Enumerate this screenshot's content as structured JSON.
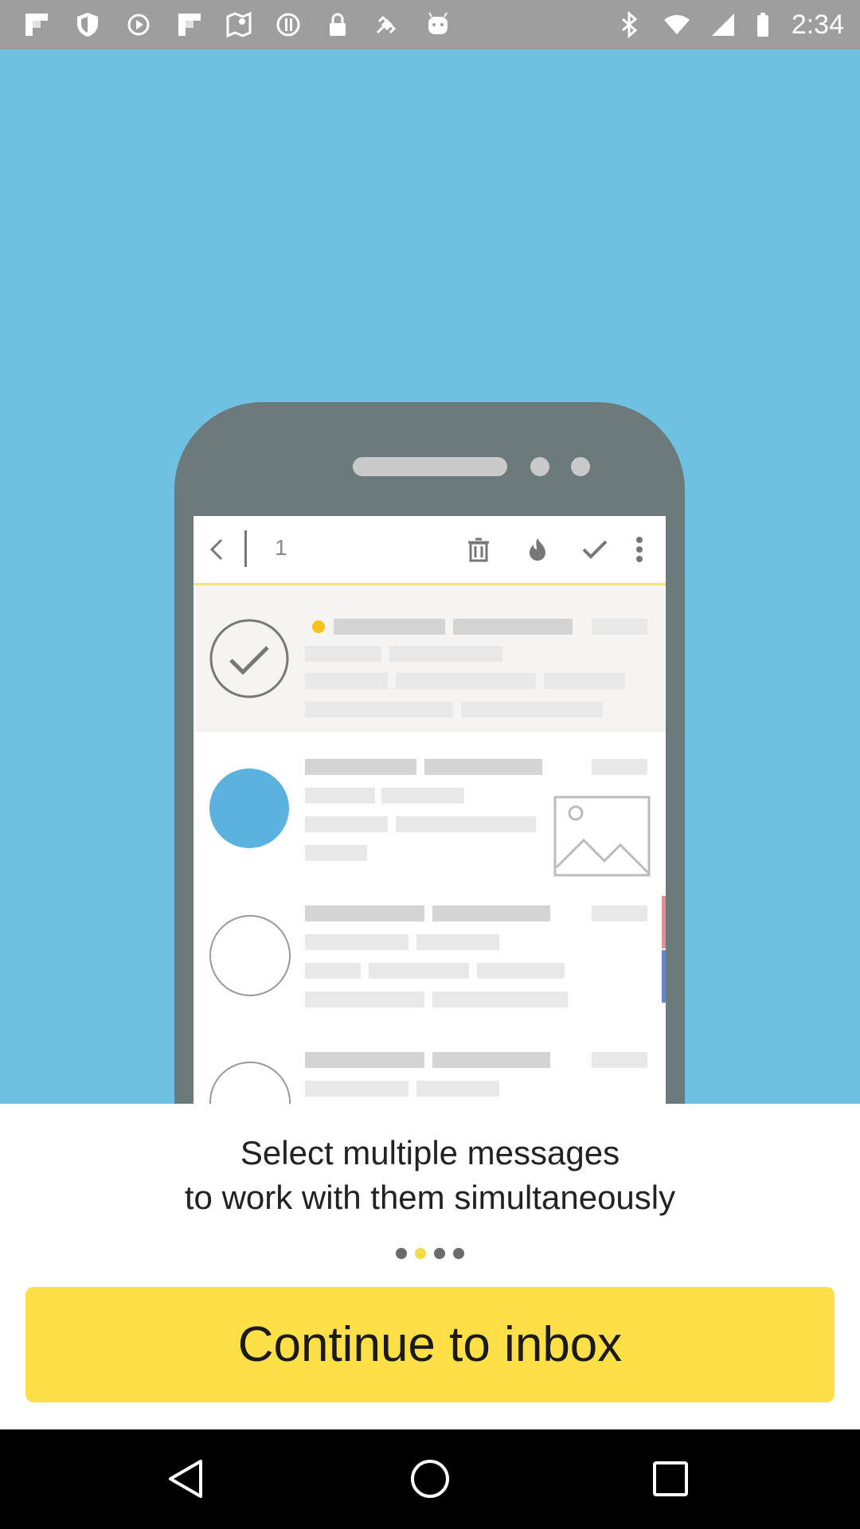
{
  "status_bar": {
    "time": "2:34",
    "left_icons": [
      "flipboard-icon",
      "shield-icon",
      "play-icon",
      "flipboard-icon-2",
      "maps-icon",
      "sync-icon",
      "lock-icon",
      "satellite-icon",
      "android-icon"
    ],
    "right_icons": [
      "bluetooth-icon",
      "wifi-icon",
      "signal-icon",
      "battery-icon"
    ]
  },
  "illustration": {
    "toolbar_count": "1",
    "toolbar_icons": [
      "back-arrow-icon",
      "trash-icon",
      "fire-icon",
      "check-icon",
      "more-icon"
    ]
  },
  "onboarding": {
    "line1": "Select multiple messages",
    "line2": "to work with them simultaneously",
    "pages_total": 4,
    "page_active": 2
  },
  "actions": {
    "continue_label": "Continue to inbox"
  },
  "colors": {
    "hero_bg": "#6ec1e0",
    "button_bg": "#fddf47",
    "accent_dot": "#f8d948"
  }
}
